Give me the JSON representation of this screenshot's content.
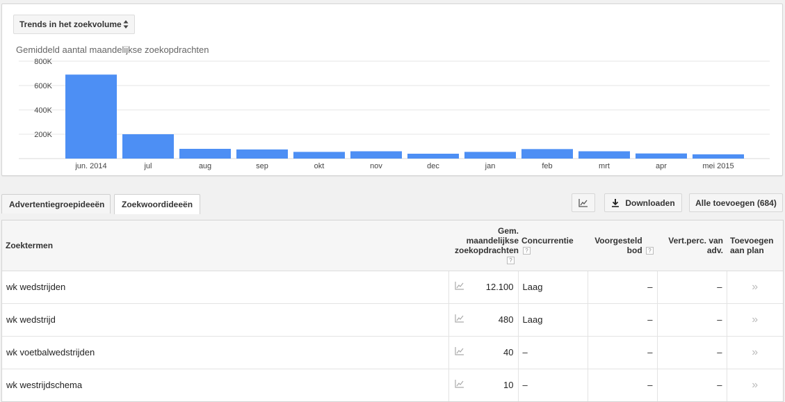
{
  "trend_select": {
    "label": "Trends in het zoekvolume"
  },
  "chart_data": {
    "type": "bar",
    "title": "Gemiddeld aantal maandelijkse zoekopdrachten",
    "categories": [
      "jun. 2014",
      "jul",
      "aug",
      "sep",
      "okt",
      "nov",
      "dec",
      "jan",
      "feb",
      "mrt",
      "apr",
      "mei 2015"
    ],
    "values": [
      690000,
      200000,
      80000,
      75000,
      55000,
      60000,
      40000,
      55000,
      78000,
      60000,
      42000,
      35000
    ],
    "ylim": [
      0,
      800000
    ],
    "yticks": [
      "800K",
      "600K",
      "400K",
      "200K"
    ],
    "ytick_values": [
      800000,
      600000,
      400000,
      200000
    ],
    "color": "#4d8ff4",
    "grid": true
  },
  "tabs": {
    "ad_groups": "Advertentiegroepideeën",
    "keywords": "Zoekwoordideeën"
  },
  "toolbar": {
    "download_label": "Downloaden",
    "add_all_label": "Alle toevoegen (684)"
  },
  "table": {
    "headers": {
      "term": "Zoektermen",
      "volume": "Gem. maandelijkse zoekopdrachten",
      "competition": "Concurrentie",
      "bid": "Voorgesteld bod",
      "share": "Vert.perc. van adv.",
      "add": "Toevoegen aan plan"
    },
    "help_glyph": "?",
    "add_glyph": "»",
    "rows": [
      {
        "term": "wk wedstrijden",
        "volume": "12.100",
        "competition": "Laag",
        "bid": "–",
        "share": "–"
      },
      {
        "term": "wk wedstrijd",
        "volume": "480",
        "competition": "Laag",
        "bid": "–",
        "share": "–"
      },
      {
        "term": "wk voetbalwedstrijden",
        "volume": "40",
        "competition": "–",
        "bid": "–",
        "share": "–"
      },
      {
        "term": "wk westrijdschema",
        "volume": "10",
        "competition": "–",
        "bid": "–",
        "share": "–"
      }
    ]
  }
}
